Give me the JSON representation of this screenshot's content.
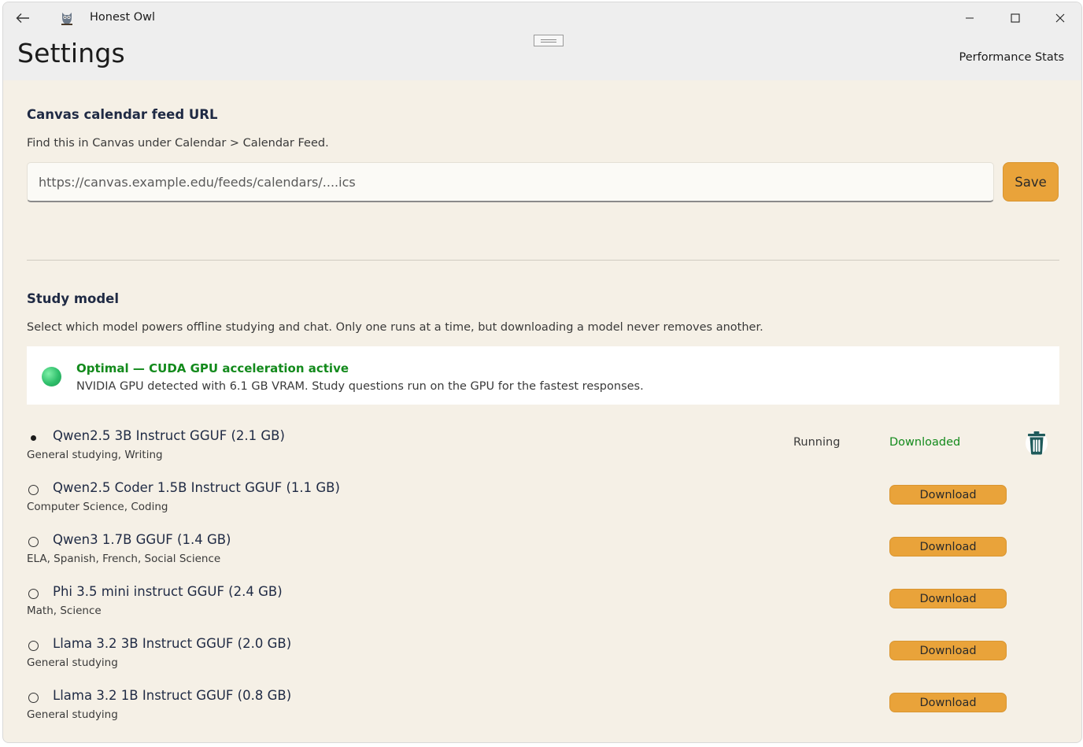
{
  "window": {
    "title": "Honest Owl"
  },
  "header": {
    "page_title": "Settings",
    "performance_link": "Performance Stats"
  },
  "calendar": {
    "title": "Canvas calendar feed URL",
    "description": "Find this in Canvas under Calendar > Calendar Feed.",
    "url_placeholder": "https://canvas.example.edu/feeds/calendars/....ics",
    "url_value": "",
    "save_label": "Save"
  },
  "study_model": {
    "title": "Study model",
    "description": "Select which model powers offline studying and chat. Only one runs at a time, but downloading a model never removes another.",
    "status": {
      "title": "Optimal — CUDA GPU acceleration active",
      "description": "NVIDIA GPU detected with 6.1 GB VRAM. Study questions run on the GPU for the fastest responses.",
      "color": "#138a1c"
    },
    "models": [
      {
        "name": "Qwen2.5 3B Instruct GGUF (2.1 GB)",
        "tags": "General studying, Writing",
        "selected": true,
        "running_label": "Running",
        "downloaded_label": "Downloaded"
      },
      {
        "name": "Qwen2.5 Coder 1.5B Instruct GGUF (1.1 GB)",
        "tags": "Computer Science, Coding",
        "selected": false,
        "download_label": "Download"
      },
      {
        "name": "Qwen3 1.7B GGUF (1.4 GB)",
        "tags": "ELA, Spanish, French, Social Science",
        "selected": false,
        "download_label": "Download"
      },
      {
        "name": "Phi 3.5 mini instruct GGUF (2.4 GB)",
        "tags": "Math, Science",
        "selected": false,
        "download_label": "Download"
      },
      {
        "name": "Llama 3.2 3B Instruct GGUF (2.0 GB)",
        "tags": "General studying",
        "selected": false,
        "download_label": "Download"
      },
      {
        "name": "Llama 3.2 1B Instruct GGUF (0.8 GB)",
        "tags": "General studying",
        "selected": false,
        "download_label": "Download"
      }
    ]
  },
  "colors": {
    "accent": "#e9a33a",
    "background": "#f5f0e6",
    "success": "#138a1c"
  }
}
